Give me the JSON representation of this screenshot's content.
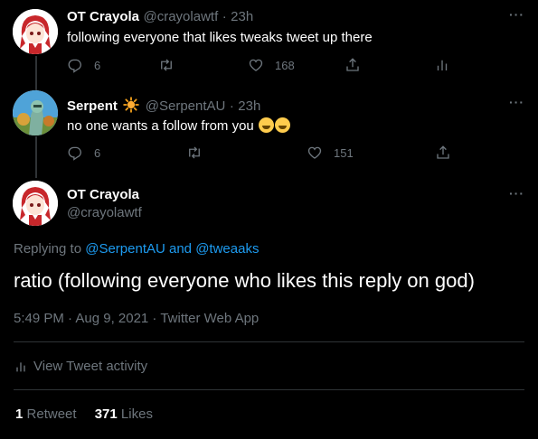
{
  "tweet1": {
    "name": "OT Crayola",
    "handle": "@crayolawtf",
    "sep": "·",
    "time": "23h",
    "text": "following everyone that likes tweaks tweet up there",
    "reply_count": "6",
    "retweet_count": "",
    "like_count": "168"
  },
  "tweet2": {
    "name": "Serpent",
    "handle": "@SerpentAU",
    "sep": "·",
    "time": "23h",
    "text": "no one wants a follow from you",
    "reply_count": "6",
    "retweet_count": "",
    "like_count": "151"
  },
  "main": {
    "name": "OT Crayola",
    "handle": "@crayolawtf",
    "replying_prefix": "Replying to",
    "replying_user1": "@SerpentAU",
    "replying_and": "and",
    "replying_user2": "@tweaaks",
    "text": "ratio (following everyone who likes this reply on god)",
    "timestamp": "5:49 PM · Aug 9, 2021 · Twitter Web App",
    "activity_label": "View Tweet activity",
    "retweets_count": "1",
    "retweets_label": "Retweet",
    "likes_count": "371",
    "likes_label": "Likes"
  },
  "more_glyph": "···",
  "colors": {
    "background": "#000000",
    "secondary_text": "#6e767d",
    "link": "#1d9bf0",
    "divider": "#2f3336"
  }
}
